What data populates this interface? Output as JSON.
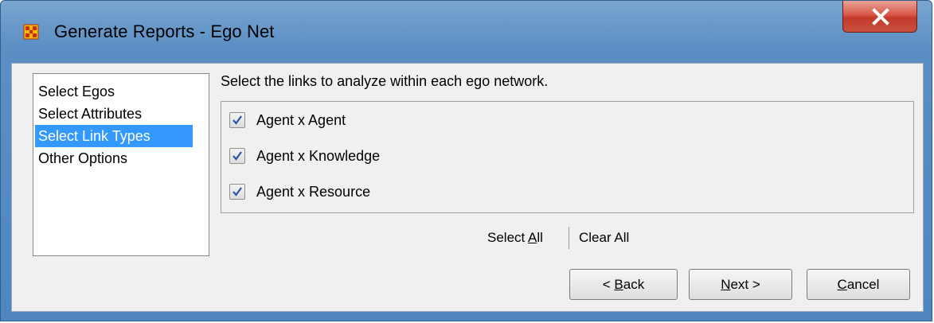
{
  "window": {
    "title": "Generate Reports - Ego Net",
    "icons": {
      "app": "grid-app-icon",
      "close": "close-icon"
    },
    "colors": {
      "titlebar": "#5b8fc4",
      "close_button": "#c8503d",
      "selection": "#3399ff"
    }
  },
  "sidebar": {
    "items": [
      {
        "label": "Select Egos",
        "selected": false
      },
      {
        "label": "Select Attributes",
        "selected": false
      },
      {
        "label": "Select Link Types",
        "selected": true
      },
      {
        "label": "Other Options",
        "selected": false
      }
    ]
  },
  "main": {
    "instruction": "Select the links to analyze within each ego network.",
    "links": [
      {
        "label": "Agent x Agent",
        "checked": true
      },
      {
        "label": "Agent x Knowledge",
        "checked": true
      },
      {
        "label": "Agent x Resource",
        "checked": true
      }
    ],
    "select_all": {
      "prefix": "Select ",
      "mnemonic": "A",
      "suffix": "ll"
    },
    "clear_all": "Clear All"
  },
  "buttons": {
    "back": {
      "prefix": "< ",
      "mnemonic": "B",
      "suffix": "ack"
    },
    "next": {
      "prefix": "",
      "mnemonic": "N",
      "suffix": "ext >"
    },
    "cancel": {
      "prefix": "",
      "mnemonic": "C",
      "suffix": "ancel"
    }
  }
}
